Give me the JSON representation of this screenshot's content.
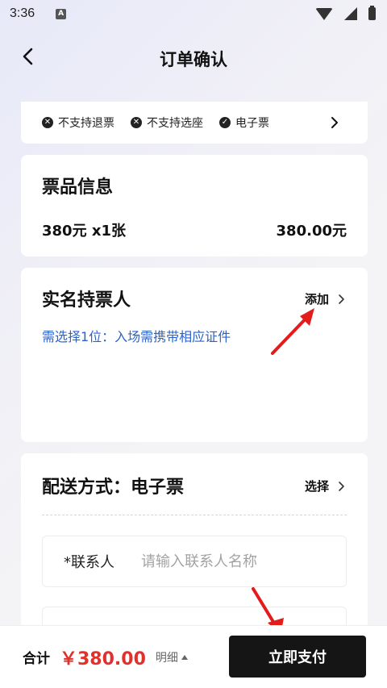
{
  "status_bar": {
    "time": "3:36",
    "app_icon_letter": "A"
  },
  "header": {
    "title": "订单确认"
  },
  "tags": [
    {
      "icon": "x-circle-icon",
      "glyph": "✕",
      "label": "不支持退票"
    },
    {
      "icon": "x-circle-icon",
      "glyph": "✕",
      "label": "不支持选座"
    },
    {
      "icon": "check-circle-icon",
      "glyph": "✓",
      "label": "电子票"
    }
  ],
  "ticket_info": {
    "title": "票品信息",
    "quantity": "380元 x1张",
    "price": "380.00元"
  },
  "ticket_holder": {
    "title": "实名持票人",
    "add_label": "添加",
    "hint": "需选择1位：入场需携带相应证件"
  },
  "delivery": {
    "title": "配送方式：电子票",
    "select_label": "选择",
    "contact_label": "*联系人",
    "contact_placeholder": "请输入联系人名称",
    "contact_value": ""
  },
  "bottom_bar": {
    "total_label": "合计",
    "total_amount": "￥380.00",
    "detail_label": "明细",
    "pay_label": "立即支付"
  },
  "colors": {
    "accent_red": "#e0312d",
    "link_blue": "#2c63c9",
    "button_dark": "#151515",
    "annotation_arrow": "#e31b1b"
  }
}
